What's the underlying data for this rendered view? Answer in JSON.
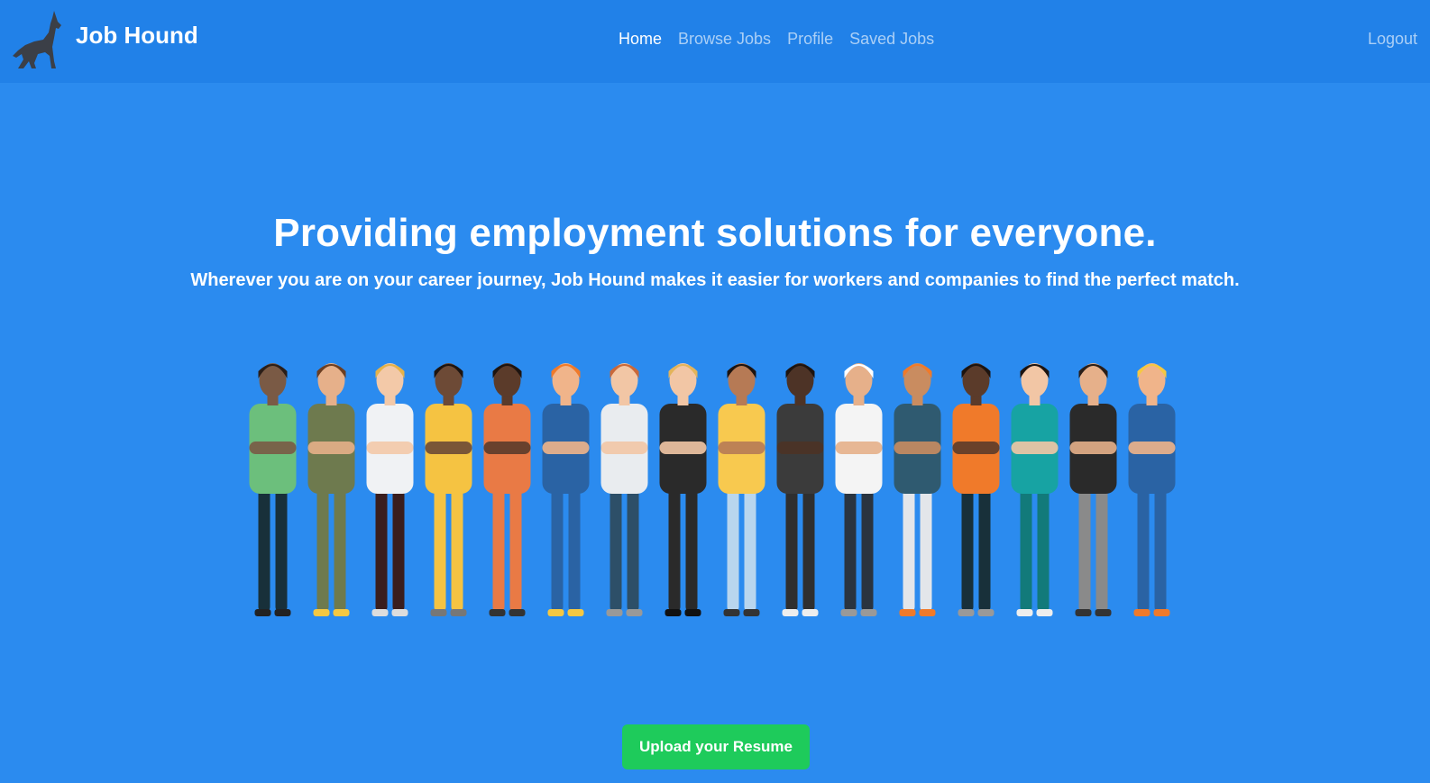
{
  "nav": {
    "brand": "Job Hound",
    "links": [
      {
        "label": "Home",
        "active": true
      },
      {
        "label": "Browse Jobs",
        "active": false
      },
      {
        "label": "Profile",
        "active": false
      },
      {
        "label": "Saved Jobs",
        "active": false
      }
    ],
    "logout": "Logout"
  },
  "hero": {
    "title": "Providing employment solutions for everyone.",
    "subtitle": "Wherever you are on your career journey, Job Hound makes it easier for workers and companies to find the perfect match."
  },
  "cta": {
    "upload_label": "Upload your Resume"
  },
  "colors": {
    "background": "#2b8bef",
    "navbar": "#2181e8",
    "cta": "#1ecb5b"
  },
  "icons": {
    "logo": "howling-wolf-icon"
  }
}
